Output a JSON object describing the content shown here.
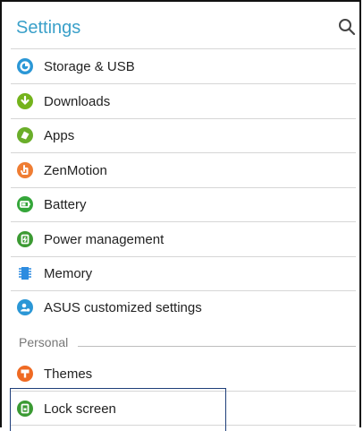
{
  "header": {
    "title": "Settings"
  },
  "items": [
    {
      "label": "Storage & USB",
      "icon": "storage-icon",
      "color": "#2b97d6"
    },
    {
      "label": "Downloads",
      "icon": "download-icon",
      "color": "#74b31c"
    },
    {
      "label": "Apps",
      "icon": "apps-icon",
      "color": "#6aae2a"
    },
    {
      "label": "ZenMotion",
      "icon": "zenmotion-icon",
      "color": "#ef7d33"
    },
    {
      "label": "Battery",
      "icon": "battery-icon",
      "color": "#35a63a"
    },
    {
      "label": "Power management",
      "icon": "power-management-icon",
      "color": "#3c9a33"
    },
    {
      "label": "Memory",
      "icon": "memory-icon",
      "color": "#2d8ce0"
    },
    {
      "label": "ASUS customized settings",
      "icon": "asus-settings-icon",
      "color": "#2b97d6"
    }
  ],
  "section": {
    "label": "Personal"
  },
  "personal_items": [
    {
      "label": "Themes",
      "icon": "themes-icon",
      "color": "#ef6a23"
    },
    {
      "label": "Lock screen",
      "icon": "lock-screen-icon",
      "color": "#3a9a33"
    }
  ]
}
